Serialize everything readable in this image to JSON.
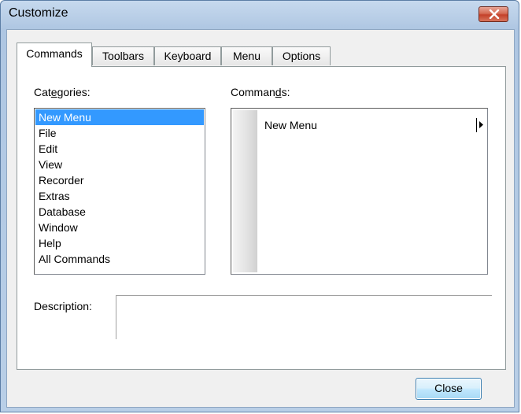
{
  "window": {
    "title": "Customize"
  },
  "tabs": [
    {
      "label": "Commands",
      "active": true
    },
    {
      "label": "Toolbars",
      "active": false
    },
    {
      "label": "Keyboard",
      "active": false
    },
    {
      "label": "Menu",
      "active": false
    },
    {
      "label": "Options",
      "active": false
    }
  ],
  "categories": {
    "label_pre": "Cat",
    "label_accel": "e",
    "label_post": "gories:",
    "items": [
      "New Menu",
      "File",
      "Edit",
      "View",
      "Recorder",
      "Extras",
      "Database",
      "Window",
      "Help",
      "All Commands"
    ],
    "selected": "New Menu"
  },
  "commands": {
    "label_pre": "Comman",
    "label_accel": "d",
    "label_post": "s:",
    "items": [
      {
        "label": "New Menu",
        "has_submenu": true
      }
    ]
  },
  "description": {
    "label": "Description:",
    "value": ""
  },
  "footer": {
    "close_label": "Close"
  },
  "icons": {
    "window_close": "close-icon",
    "submenu": "submenu-arrow-icon"
  },
  "colors": {
    "selection": "#3399ff",
    "close_button_red": "#c4412a"
  }
}
